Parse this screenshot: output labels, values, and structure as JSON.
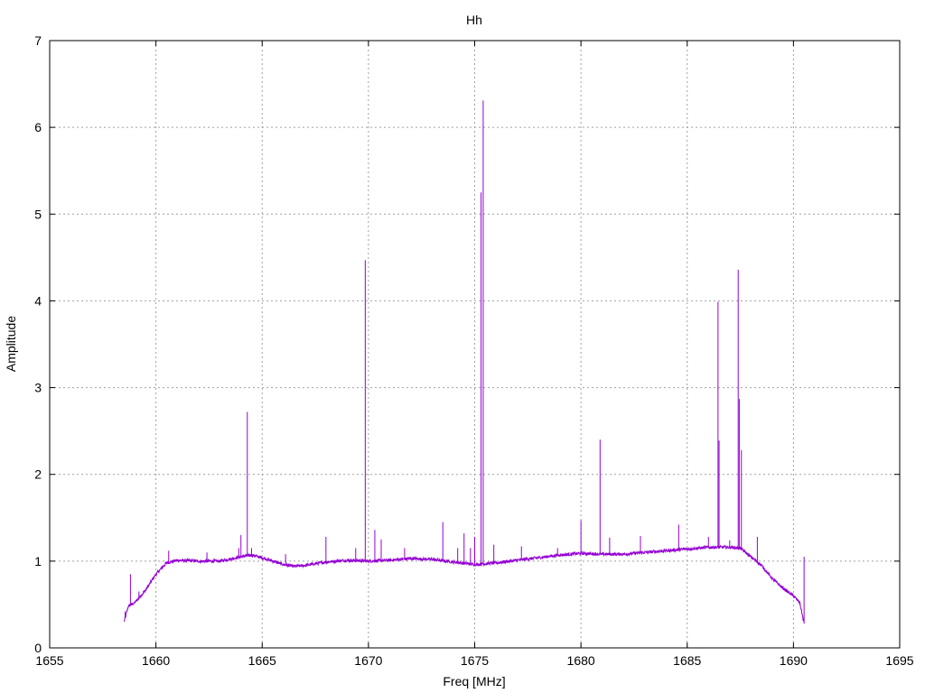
{
  "chart_data": {
    "type": "line",
    "title": "Hh",
    "xlabel": "Freq [MHz]",
    "ylabel": "Amplitude",
    "xlim": [
      1655,
      1695
    ],
    "ylim": [
      0,
      7
    ],
    "xticks": [
      "1655",
      "1660",
      "1665",
      "1670",
      "1675",
      "1680",
      "1685",
      "1690",
      "1695"
    ],
    "yticks": [
      "0",
      "1",
      "2",
      "3",
      "4",
      "5",
      "6",
      "7"
    ],
    "grid": true,
    "series_color": "#9400d3",
    "baseline": [
      [
        1658.5,
        0.3
      ],
      [
        1658.7,
        0.48
      ],
      [
        1659.0,
        0.52
      ],
      [
        1659.5,
        0.66
      ],
      [
        1660.0,
        0.85
      ],
      [
        1660.5,
        0.98
      ],
      [
        1661.0,
        1.01
      ],
      [
        1662.0,
        1.0
      ],
      [
        1663.0,
        1.0
      ],
      [
        1664.0,
        1.05
      ],
      [
        1664.5,
        1.07
      ],
      [
        1665.0,
        1.04
      ],
      [
        1665.5,
        1.0
      ],
      [
        1666.0,
        0.96
      ],
      [
        1666.5,
        0.94
      ],
      [
        1667.0,
        0.95
      ],
      [
        1668.0,
        0.99
      ],
      [
        1669.0,
        1.01
      ],
      [
        1670.0,
        1.0
      ],
      [
        1671.0,
        1.01
      ],
      [
        1672.0,
        1.03
      ],
      [
        1673.0,
        1.02
      ],
      [
        1674.0,
        0.99
      ],
      [
        1675.0,
        0.96
      ],
      [
        1676.0,
        0.98
      ],
      [
        1677.0,
        1.01
      ],
      [
        1678.0,
        1.04
      ],
      [
        1679.0,
        1.07
      ],
      [
        1680.0,
        1.09
      ],
      [
        1681.0,
        1.08
      ],
      [
        1682.0,
        1.08
      ],
      [
        1683.0,
        1.1
      ],
      [
        1684.0,
        1.12
      ],
      [
        1685.0,
        1.14
      ],
      [
        1686.0,
        1.16
      ],
      [
        1687.0,
        1.16
      ],
      [
        1687.5,
        1.15
      ],
      [
        1688.0,
        1.05
      ],
      [
        1688.5,
        0.95
      ],
      [
        1689.0,
        0.8
      ],
      [
        1689.5,
        0.69
      ],
      [
        1690.0,
        0.6
      ],
      [
        1690.3,
        0.52
      ],
      [
        1690.5,
        0.28
      ]
    ],
    "spikes": [
      [
        1658.55,
        0.42
      ],
      [
        1658.8,
        0.85
      ],
      [
        1659.2,
        0.65
      ],
      [
        1660.6,
        1.12
      ],
      [
        1662.4,
        1.1
      ],
      [
        1663.9,
        1.15
      ],
      [
        1664.0,
        1.3
      ],
      [
        1664.3,
        2.72
      ],
      [
        1664.5,
        1.15
      ],
      [
        1666.1,
        1.08
      ],
      [
        1668.0,
        1.28
      ],
      [
        1669.4,
        1.15
      ],
      [
        1669.85,
        4.47
      ],
      [
        1670.3,
        1.36
      ],
      [
        1670.6,
        1.25
      ],
      [
        1671.7,
        1.15
      ],
      [
        1673.5,
        1.45
      ],
      [
        1674.2,
        1.15
      ],
      [
        1674.5,
        1.32
      ],
      [
        1674.8,
        1.15
      ],
      [
        1675.0,
        1.28
      ],
      [
        1675.3,
        5.25
      ],
      [
        1675.4,
        6.31
      ],
      [
        1675.9,
        1.19
      ],
      [
        1677.2,
        1.17
      ],
      [
        1678.9,
        1.15
      ],
      [
        1680.0,
        1.47
      ],
      [
        1680.9,
        2.4
      ],
      [
        1681.35,
        1.27
      ],
      [
        1682.8,
        1.29
      ],
      [
        1684.6,
        1.42
      ],
      [
        1686.0,
        1.28
      ],
      [
        1686.45,
        3.99
      ],
      [
        1686.5,
        2.39
      ],
      [
        1687.0,
        1.24
      ],
      [
        1687.4,
        4.36
      ],
      [
        1687.45,
        2.87
      ],
      [
        1687.55,
        2.28
      ],
      [
        1688.3,
        1.28
      ],
      [
        1690.5,
        1.05
      ]
    ]
  }
}
